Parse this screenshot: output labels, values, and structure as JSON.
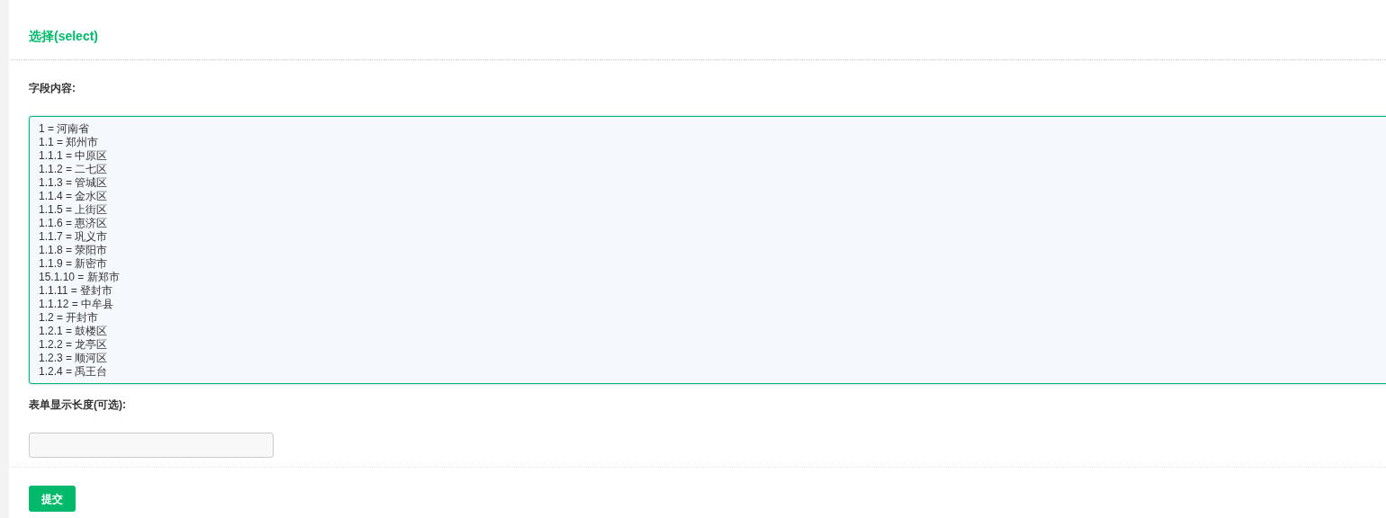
{
  "section_title": "选择(select)",
  "fields": [
    {
      "kind": "textarea",
      "label": "字段内容:",
      "lines": [
        "1 = 河南省",
        "1.1 = 郑州市",
        "1.1.1 = 中原区",
        "1.1.2 = 二七区",
        "1.1.3 = 管城区",
        "1.1.4 = 金水区",
        "1.1.5 = 上街区",
        "1.1.6 = 惠济区",
        "1.1.7 = 巩义市",
        "1.1.8 = 荥阳市",
        "1.1.9 = 新密市",
        "15.1.10 = 新郑市",
        "1.1.11 = 登封市",
        "1.1.12 = 中牟县",
        "1.2 = 开封市",
        "1.2.1 = 鼓楼区",
        "1.2.2 = 龙亭区",
        "1.2.3 = 顺河区",
        "1.2.4 = 禹王台"
      ]
    },
    {
      "kind": "input",
      "label": "表单显示长度(可选):"
    }
  ],
  "submit_button": "提交"
}
